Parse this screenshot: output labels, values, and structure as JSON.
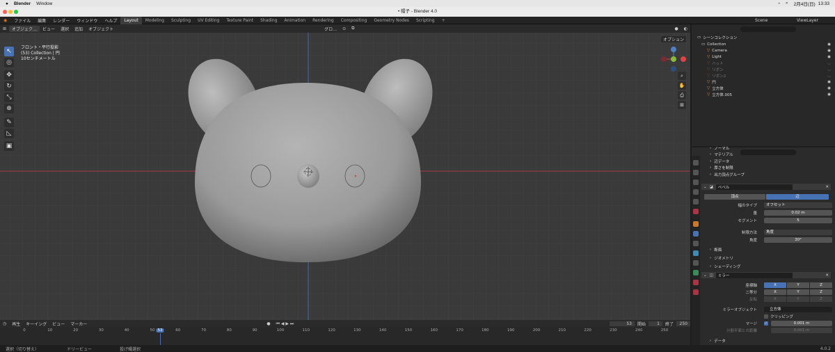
{
  "mac_menu": {
    "app": "Blender",
    "window": "Window",
    "date": "2月4日(日)",
    "time": "13:33"
  },
  "window_title": "• 帽子 - Blender 4.0",
  "menu": {
    "file": "ファイル",
    "edit": "編集",
    "render": "レンダー",
    "window": "ウィンドウ",
    "help": "ヘルプ"
  },
  "workspaces": [
    "Layout",
    "Modeling",
    "Sculpting",
    "UV Editing",
    "Texture Paint",
    "Shading",
    "Animation",
    "Rendering",
    "Compositing",
    "Geometry Nodes",
    "Scripting"
  ],
  "scene": "Scene",
  "view_layer": "ViewLayer",
  "viewport_header": {
    "mode": "オブジェク…",
    "view": "ビュー",
    "select": "選択",
    "add": "追加",
    "object": "オブジェクト",
    "transform": "グロ…",
    "options": "オプション"
  },
  "viewport_info": [
    "フロント・平行投影",
    "(53) Collection | 円",
    "10センチメートル"
  ],
  "timeline": {
    "menu": [
      "再生",
      "キーイング",
      "ビュー",
      "マーカー"
    ],
    "current_frame": "53",
    "start_label": "開始",
    "start": "1",
    "end_label": "終了",
    "end": "250",
    "ticks": [
      "0",
      "10",
      "20",
      "30",
      "40",
      "50",
      "53",
      "60",
      "70",
      "80",
      "90",
      "100",
      "110",
      "120",
      "130",
      "140",
      "150",
      "160",
      "170",
      "180",
      "190",
      "200",
      "210",
      "220",
      "230",
      "240",
      "250"
    ]
  },
  "status_bar": {
    "select": "選択（切り替え）",
    "dolly": "ドリービュー",
    "lasso": "投げ縄選択",
    "version": "4.0.2"
  },
  "outliner": {
    "root": "シーンコレクション",
    "collection": "Collection",
    "items": [
      {
        "name": "Camera",
        "dim": false
      },
      {
        "name": "Light",
        "dim": false
      },
      {
        "name": "ハット",
        "dim": true
      },
      {
        "name": "リボン",
        "dim": true
      },
      {
        "name": "リボン2",
        "dim": true
      },
      {
        "name": "円",
        "dim": false
      },
      {
        "name": "立方体",
        "dim": false
      },
      {
        "name": "立方体.005",
        "dim": false
      }
    ]
  },
  "properties": {
    "sections_top": [
      "ノーマル",
      "マテリアル",
      "辺データ",
      "厚さを制限",
      "出力頂点グループ"
    ],
    "bevel": {
      "name": "ベベル",
      "vertex": "頂点",
      "edge": "辺",
      "width_type_label": "幅のタイプ",
      "width_type": "オフセット",
      "amount_label": "量",
      "amount": "0.02 m",
      "segments_label": "セグメント",
      "segments": "5",
      "limit_label": "制限方法",
      "limit": "角度",
      "angle_label": "角度",
      "angle": "30°",
      "subsections": [
        "断面",
        "ジオメトリ",
        "シェーディング"
      ]
    },
    "mirror": {
      "name": "ミラー",
      "axis_label": "座標軸",
      "bisect_label": "二等分",
      "flip_label": "反転",
      "x": "X",
      "y": "Y",
      "z": "Z",
      "mirror_object_label": "ミラーオブジェクト",
      "mirror_object": "立方体",
      "clipping": "クリッピング",
      "merge_label": "マージ",
      "merge": "0.001 m",
      "bisect_distance_label": "分割平面との距離",
      "bisect_distance": "0.001 m",
      "data": "データ"
    }
  },
  "colors": {
    "accent": "#4772b3",
    "x_axis": "#b03a48",
    "y_axis": "#3f6fb3"
  }
}
